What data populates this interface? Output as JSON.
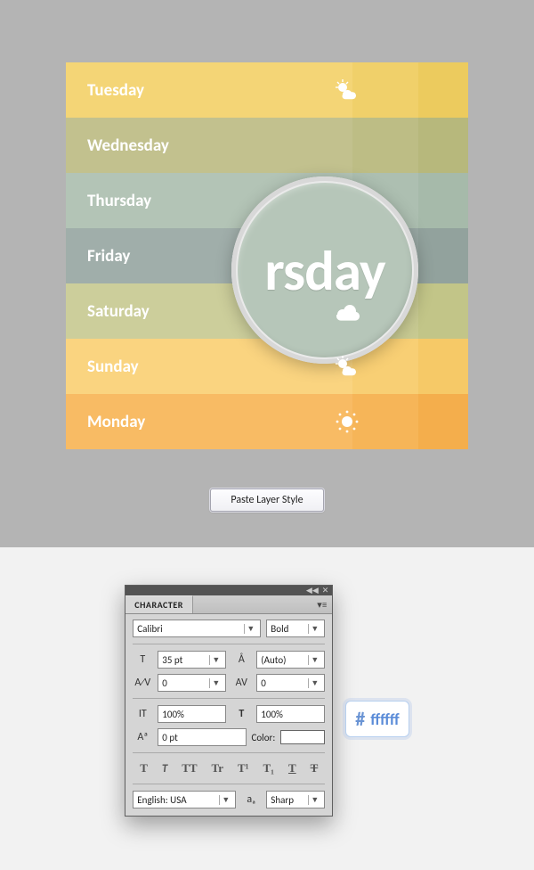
{
  "days": [
    {
      "label": "Tuesday",
      "icon": "partly-sunny"
    },
    {
      "label": "Wednesday",
      "icon": ""
    },
    {
      "label": "Thursday",
      "icon": ""
    },
    {
      "label": "Friday",
      "icon": ""
    },
    {
      "label": "Saturday",
      "icon": "cloudy"
    },
    {
      "label": "Sunday",
      "icon": "partly-sunny"
    },
    {
      "label": "Monday",
      "icon": "sunny"
    }
  ],
  "magnifier": {
    "text": "rsday"
  },
  "button": {
    "label": "Paste Layer Style"
  },
  "panel": {
    "title": "CHARACTER",
    "font": "Calibri",
    "weight": "Bold",
    "size": "35 pt",
    "leading": "(Auto)",
    "kerning": "0",
    "tracking": "0",
    "vscale": "100%",
    "hscale": "100%",
    "baseline": "0 pt",
    "color_label": "Color:",
    "lang": "English: USA",
    "aa": "Sharp"
  },
  "swatch": {
    "symbol": "#",
    "value": "ffffff"
  }
}
